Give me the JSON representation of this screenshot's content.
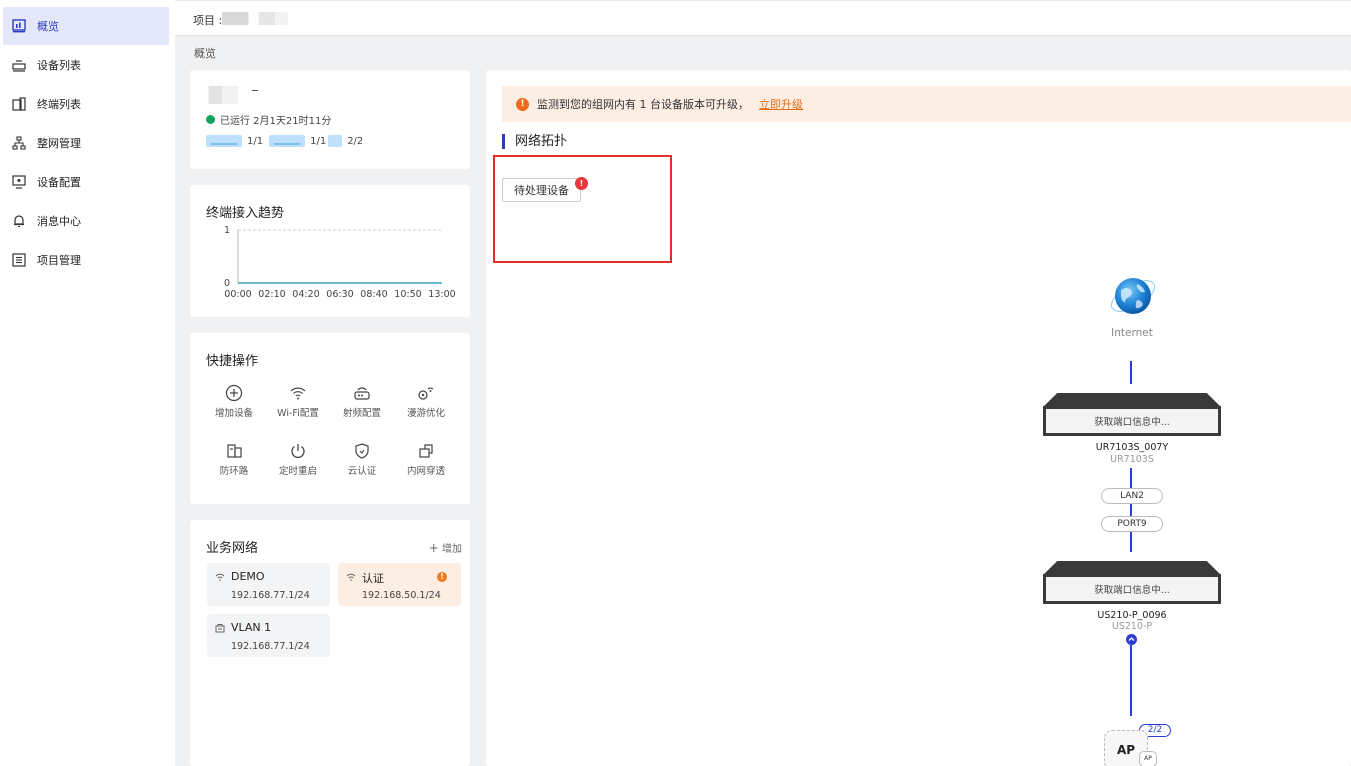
{
  "sidebar": {
    "items": [
      {
        "label": "概览",
        "icon": "dashboard-icon"
      },
      {
        "label": "设备列表",
        "icon": "device-list-icon"
      },
      {
        "label": "终端列表",
        "icon": "terminal-list-icon"
      },
      {
        "label": "整网管理",
        "icon": "network-tree-icon"
      },
      {
        "label": "设备配置",
        "icon": "device-config-icon"
      },
      {
        "label": "消息中心",
        "icon": "bell-icon"
      },
      {
        "label": "项目管理",
        "icon": "project-list-icon"
      }
    ]
  },
  "header": {
    "project_label": "项目 :"
  },
  "breadcrumb": "概览",
  "device_card": {
    "uptime": "已运行 2月1天21时11分",
    "router_count": "1/1",
    "switch_count": "1/1",
    "ap_count": "2/2"
  },
  "trend": {
    "title": "终端接入趋势"
  },
  "chart_data": {
    "type": "line",
    "title": "终端接入趋势",
    "xlabel": "",
    "ylabel": "",
    "categories": [
      "00:00",
      "02:10",
      "04:20",
      "06:30",
      "08:40",
      "10:50",
      "13:00"
    ],
    "values": [
      0,
      0,
      0,
      0,
      0,
      0,
      0
    ],
    "ylim": [
      0,
      1
    ],
    "yticks": [
      "0",
      "1"
    ],
    "grid": true
  },
  "quick": {
    "title": "快捷操作",
    "actions": [
      {
        "label": "增加设备",
        "icon": "plus-circle-icon"
      },
      {
        "label": "Wi-Fi配置",
        "icon": "wifi-icon"
      },
      {
        "label": "射频配置",
        "icon": "radio-icon"
      },
      {
        "label": "漫游优化",
        "icon": "roaming-icon"
      },
      {
        "label": "防环路",
        "icon": "loop-guard-icon"
      },
      {
        "label": "定时重启",
        "icon": "power-icon"
      },
      {
        "label": "云认证",
        "icon": "shield-icon"
      },
      {
        "label": "内网穿透",
        "icon": "tunnel-icon"
      }
    ]
  },
  "business": {
    "title": "业务网络",
    "add_label": "增加",
    "networks": [
      {
        "name": "DEMO",
        "ip": "192.168.77.1/24",
        "icon": "wifi-icon"
      },
      {
        "name": "认证",
        "ip": "192.168.50.1/24",
        "icon": "wifi-icon",
        "badge": "!"
      },
      {
        "name": "VLAN 1",
        "ip": "192.168.77.1/24",
        "icon": "lan-icon"
      }
    ]
  },
  "topology": {
    "banner_icon": "!",
    "banner_text": "监测到您的组网内有 1 台设备版本可升级，",
    "banner_link": "立即升级",
    "title": "网络拓扑",
    "pending_button": "待处理设备",
    "pending_badge": "!",
    "internet_label": "Internet",
    "router": {
      "status": "获取端口信息中...",
      "name": "UR7103S_007Y",
      "model": "UR7103S"
    },
    "port_up": "LAN2",
    "port_down": "PORT9",
    "switch": {
      "status": "获取端口信息中...",
      "name": "US210-P_0096",
      "model": "US210-P"
    },
    "ap_count": "2/2",
    "ap_label": "AP",
    "ap_sub": "AP"
  },
  "colors": {
    "accent": "#2e3dbd",
    "warning": "#ef6c1f",
    "danger": "#e32c2c",
    "link_line": "#2a3fd1"
  }
}
